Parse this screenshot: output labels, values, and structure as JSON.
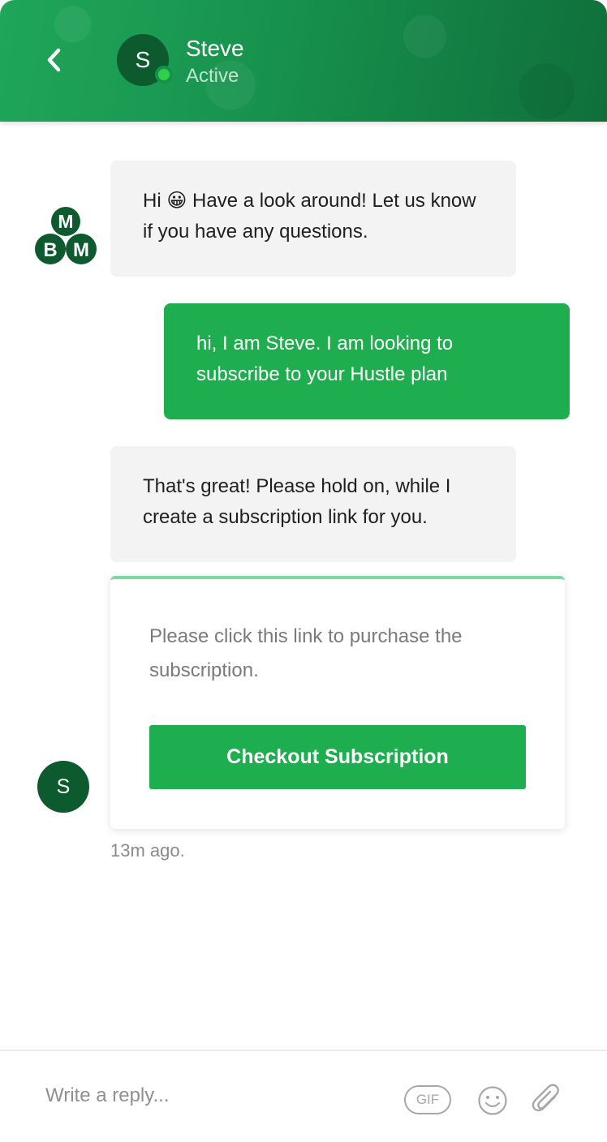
{
  "header": {
    "back_icon": "chevron-left-icon",
    "avatar_initial": "S",
    "contact_name": "Steve",
    "contact_status": "Active",
    "status_color": "#2fd14a"
  },
  "messages": [
    {
      "from": "agent",
      "avatar": "mbm-logo",
      "before_emoji": "Hi ",
      "emoji": "😀",
      "text": " Have a look around! Let us know if you have any questions."
    },
    {
      "from": "user",
      "text": "hi, I am Steve. I am looking to subscribe to your Hustle plan"
    },
    {
      "from": "agent",
      "text": "That's great! Please hold on, while I create a subscription link for you."
    }
  ],
  "brand": {
    "letters_top": "M",
    "letters_left": "B",
    "letters_right": "M"
  },
  "link_card": {
    "text": "Please click this link to purchase the subscription.",
    "button_label": "Checkout Subscription"
  },
  "user_avatar_initial": "S",
  "timestamp": "13m ago.",
  "composer": {
    "placeholder": "Write a reply...",
    "gif_label": "GIF",
    "emoji_icon": "smiley-icon",
    "attach_icon": "paperclip-icon"
  },
  "colors": {
    "brand_green": "#1fae4f",
    "dark_green": "#0e5a2f",
    "bubble_gray": "#f3f3f3"
  }
}
